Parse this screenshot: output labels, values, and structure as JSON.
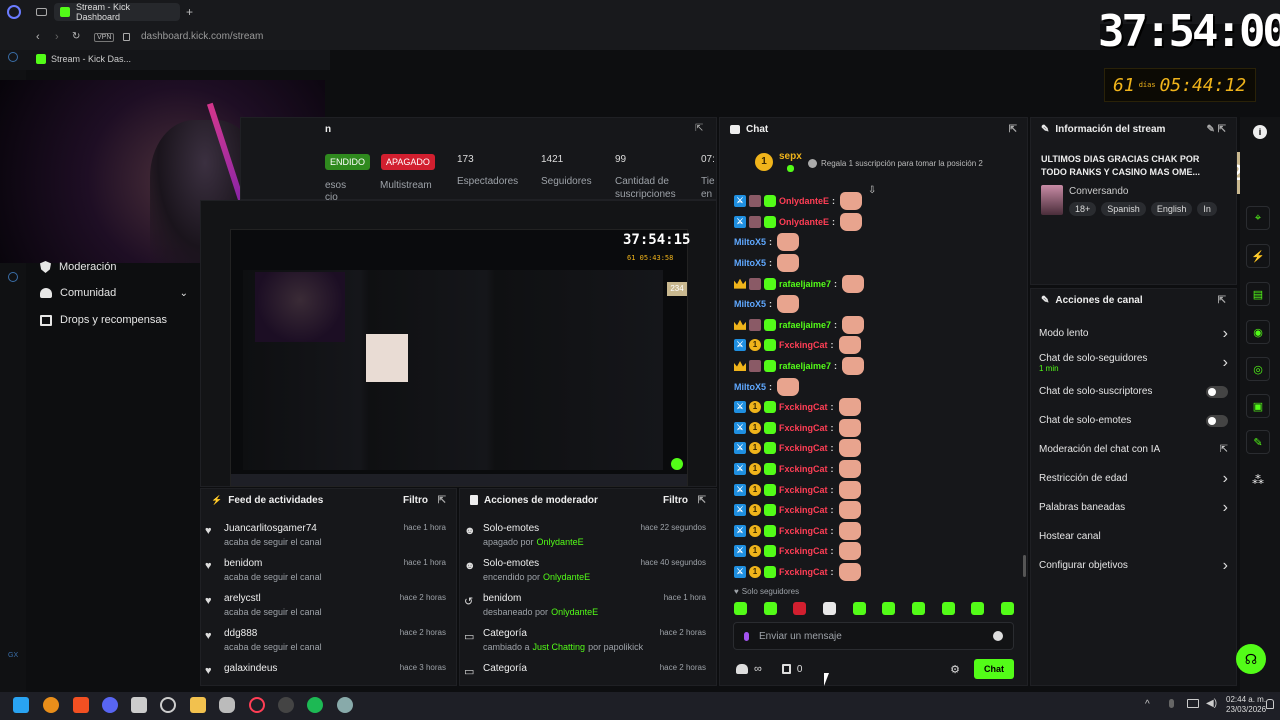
{
  "browser": {
    "tab_title": "Stream - Kick Dashboard",
    "url": "dashboard.kick.com/stream",
    "vpn": "VPN",
    "bookmark": "Stream - Kick Das..."
  },
  "overlay": {
    "timer_big": "37:54:00",
    "days_num": "61",
    "days_label": "días",
    "days_time": "05:44:12",
    "counter": "234"
  },
  "stats": {
    "status_label": "ENDIDO",
    "multistream_badge": "APAGADO",
    "multistream_label": "Multistream",
    "spectators_num": "173",
    "spectators_label": "Espectadores",
    "followers_num": "1421",
    "followers_label": "Seguidores",
    "subs_num": "99",
    "subs_label1": "Cantidad de",
    "subs_label2": "suscripciones",
    "time_num": "07:",
    "time_label1": "Tie",
    "time_label2": "en",
    "left_partial1": "esos",
    "left_partial2": "cio"
  },
  "leftnav": {
    "moderation": "Moderación",
    "community": "Comunidad",
    "drops": "Drops y recompensas"
  },
  "preview": {
    "timer": "37:54:15",
    "subtimer": "61 05:43:58",
    "counter": "234"
  },
  "feed": {
    "title": "Feed de actividades",
    "filter": "Filtro",
    "items": [
      {
        "name": "Juancarlitosgamer74",
        "sub": "acaba de seguir el canal",
        "time": "hace 1 hora"
      },
      {
        "name": "benidom",
        "sub": "acaba de seguir el canal",
        "time": "hace 1 hora"
      },
      {
        "name": "arelycstl",
        "sub": "acaba de seguir el canal",
        "time": "hace 2 horas"
      },
      {
        "name": "ddg888",
        "sub": "acaba de seguir el canal",
        "time": "hace 2 horas"
      },
      {
        "name": "galaxindeus",
        "sub": "",
        "time": "hace 3 horas"
      }
    ]
  },
  "modactions": {
    "title": "Acciones de moderador",
    "filter": "Filtro",
    "items": [
      {
        "title": "Solo-emotes",
        "sub_pre": "apagado por",
        "user": "OnlydanteE",
        "sub_post": "",
        "time": "hace 22 segundos"
      },
      {
        "title": "Solo-emotes",
        "sub_pre": "encendido por",
        "user": "OnlydanteE",
        "sub_post": "",
        "time": "hace 40 segundos"
      },
      {
        "title": "benidom",
        "sub_pre": "desbaneado por",
        "user": "OnlydanteE",
        "sub_post": "",
        "time": "hace 1 hora"
      },
      {
        "title": "Categoría",
        "sub_pre": "cambiado a",
        "user": "Just Chatting",
        "sub_post": "por papolikick",
        "time": "hace 2 horas"
      },
      {
        "title": "Categoría",
        "sub_pre": "",
        "user": "",
        "sub_post": "",
        "time": "hace 2 horas"
      }
    ]
  },
  "chat": {
    "title": "Chat",
    "top_user": "sepx",
    "top_rank": "1",
    "top_msg": "Regala 1 suscripción para tomar la posición 2",
    "lines": [
      {
        "type": "mod",
        "name": "OnlydanteE",
        "color": "red"
      },
      {
        "type": "mod",
        "name": "OnlydanteE",
        "color": "red"
      },
      {
        "type": "plain",
        "name": "MiltoX5",
        "color": "blue"
      },
      {
        "type": "plain",
        "name": "MiltoX5",
        "color": "blue"
      },
      {
        "type": "vip",
        "name": "rafaeljaime7",
        "color": "green"
      },
      {
        "type": "plain",
        "name": "MiltoX5",
        "color": "blue"
      },
      {
        "type": "vip",
        "name": "rafaeljaime7",
        "color": "green"
      },
      {
        "type": "sub",
        "name": "FxckingCat",
        "color": "red"
      },
      {
        "type": "vip",
        "name": "rafaeljaime7",
        "color": "green"
      },
      {
        "type": "plain",
        "name": "MiltoX5",
        "color": "blue"
      },
      {
        "type": "sub",
        "name": "FxckingCat",
        "color": "red"
      },
      {
        "type": "sub",
        "name": "FxckingCat",
        "color": "red"
      },
      {
        "type": "sub",
        "name": "FxckingCat",
        "color": "red"
      },
      {
        "type": "sub",
        "name": "FxckingCat",
        "color": "red"
      },
      {
        "type": "sub",
        "name": "FxckingCat",
        "color": "red"
      },
      {
        "type": "sub",
        "name": "FxckingCat",
        "color": "red"
      },
      {
        "type": "sub",
        "name": "FxckingCat",
        "color": "red"
      },
      {
        "type": "sub",
        "name": "FxckingCat",
        "color": "red"
      },
      {
        "type": "sub",
        "name": "FxckingCat",
        "color": "red"
      }
    ],
    "followers_only": "Solo seguidores",
    "input_placeholder": "Enviar un mensaje",
    "count": "0",
    "send": "Chat"
  },
  "streaminfo": {
    "title": "Información del stream",
    "stream_title": "ULTIMOS DIAS GRACIAS CHAK POR TODO RANKS Y CASINO MAS OME...",
    "category": "Conversando",
    "tags": [
      "18+",
      "Spanish",
      "English",
      "In"
    ]
  },
  "channel_actions": {
    "title": "Acciones de canal",
    "items": [
      {
        "label": "Modo lento",
        "sub": "",
        "control": "arrow"
      },
      {
        "label": "Chat de solo-seguidores",
        "sub": "1 min",
        "control": "arrow"
      },
      {
        "label": "Chat de solo-suscriptores",
        "sub": "",
        "control": "toggle"
      },
      {
        "label": "Chat de solo-emotes",
        "sub": "",
        "control": "toggle"
      },
      {
        "label": "Moderación del chat con IA",
        "sub": "",
        "control": "ext"
      },
      {
        "label": "Restricción de edad",
        "sub": "",
        "control": "arrow"
      },
      {
        "label": "Palabras baneadas",
        "sub": "",
        "control": "arrow"
      },
      {
        "label": "Hostear canal",
        "sub": "",
        "control": "none"
      },
      {
        "label": "Configurar objetivos",
        "sub": "",
        "control": "arrow"
      }
    ]
  },
  "taskbar": {
    "time": "02:44 a. m.",
    "date": "23/03/2026"
  },
  "colors": {
    "kick_green": "#53fc18",
    "danger_red": "#ff3e55",
    "mod_blue": "#1f8fe0"
  }
}
